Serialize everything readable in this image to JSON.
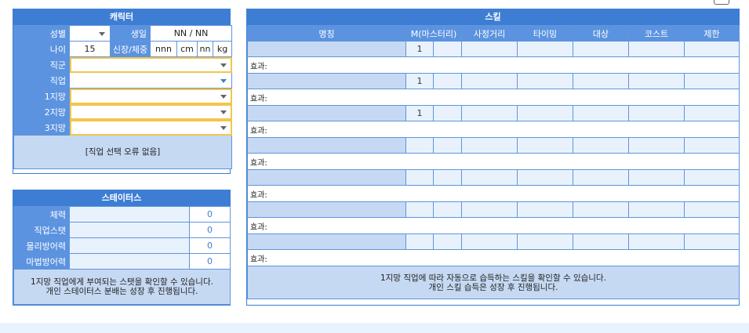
{
  "character": {
    "title": "캐릭터",
    "gender_label": "성별",
    "gender_value": "",
    "birth_label": "생일",
    "birth_value": "NN / NN",
    "age_label": "나이",
    "age_value": "15",
    "height_weight_label": "신장/체중",
    "height_value": "nnn",
    "height_unit": "cm",
    "weight_value": "nn",
    "weight_unit": "kg",
    "class_label": "직군",
    "job_label": "직업",
    "choice1_label": "1지망",
    "choice2_label": "2지망",
    "choice3_label": "3지망",
    "job_error_note": "[직업 선택 오류 없음]"
  },
  "status": {
    "title": "스테이터스",
    "rows": [
      {
        "label": "체력",
        "value": "0"
      },
      {
        "label": "직업스탯",
        "value": "0"
      },
      {
        "label": "물리방어력",
        "value": "0"
      },
      {
        "label": "마법방어력",
        "value": "0"
      }
    ],
    "note_line1": "1지망 직업에게 부여되는 스탯을 확인할 수 있습니다.",
    "note_line2": "개인 스테이터스 분배는 성장 후 진행됩니다."
  },
  "skills": {
    "title": "스킬",
    "columns": [
      "명칭",
      "M(마스터리)",
      "사정거리",
      "타이밍",
      "대상",
      "코스트",
      "제한"
    ],
    "effect_label": "효과:",
    "rows": [
      {
        "level": "1"
      },
      {
        "level": "1"
      },
      {
        "level": "1"
      },
      {
        "level": ""
      },
      {
        "level": ""
      },
      {
        "level": ""
      },
      {
        "level": ""
      }
    ],
    "note_line1": "1지망 직업에 따라 자동으로 습득하는 스킬을 확인할 수 있습니다.",
    "note_line2": "개인 스킬 습득은 성장 후 진행됩니다."
  }
}
